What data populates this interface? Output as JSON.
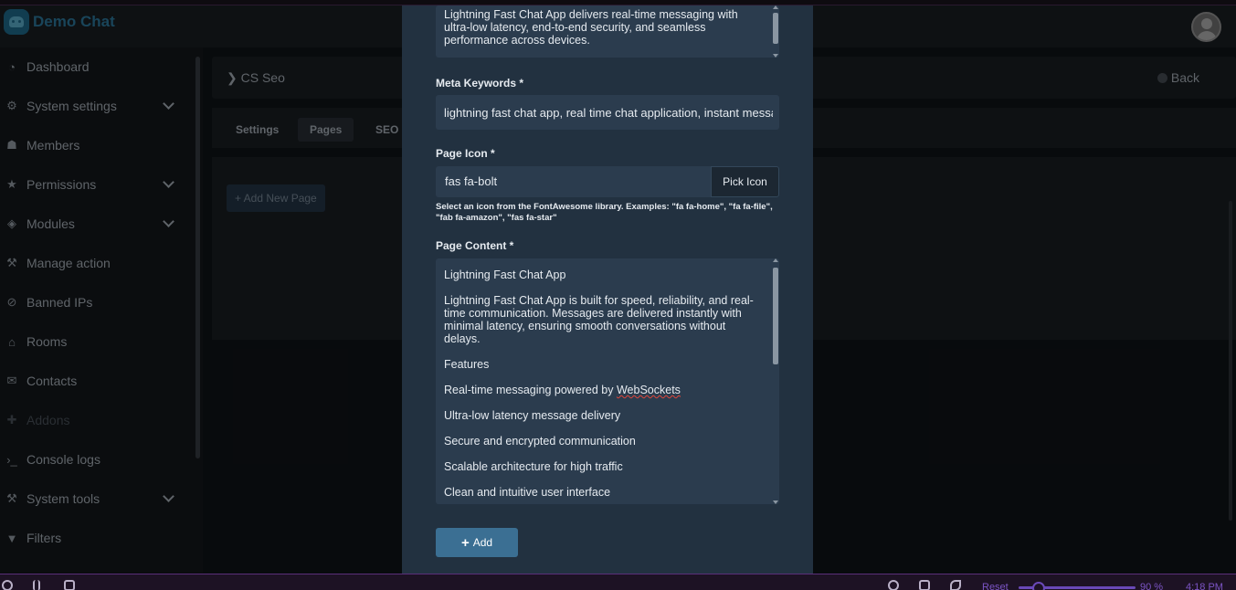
{
  "app": {
    "brand": "Demo Chat"
  },
  "sidebar": {
    "items": [
      {
        "label": "Dashboard",
        "icon": "dashboard-icon",
        "chevron": false
      },
      {
        "label": "System settings",
        "icon": "cogs-icon",
        "chevron": true
      },
      {
        "label": "Members",
        "icon": "users-icon",
        "chevron": false
      },
      {
        "label": "Permissions",
        "icon": "star-icon",
        "chevron": true
      },
      {
        "label": "Modules",
        "icon": "cubes-icon",
        "chevron": true
      },
      {
        "label": "Manage action",
        "icon": "hammer-icon",
        "chevron": false
      },
      {
        "label": "Banned IPs",
        "icon": "ban-icon",
        "chevron": false
      },
      {
        "label": "Rooms",
        "icon": "home-icon",
        "chevron": false
      },
      {
        "label": "Contacts",
        "icon": "envelope-icon",
        "chevron": false
      },
      {
        "label": "Addons",
        "icon": "puzzle-icon",
        "chevron": false
      },
      {
        "label": "Console logs",
        "icon": "terminal-icon",
        "chevron": false
      },
      {
        "label": "System tools",
        "icon": "wrench-icon",
        "chevron": true
      },
      {
        "label": "Filters",
        "icon": "filter-icon",
        "chevron": false
      }
    ]
  },
  "main": {
    "breadcrumb": "CS Seo",
    "back_label": "Back",
    "tabs": [
      {
        "label": "Settings"
      },
      {
        "label": "Pages"
      },
      {
        "label": "SEO C"
      }
    ],
    "add_new_page": "+ Add New Page"
  },
  "modal": {
    "description_text": "Lightning Fast Chat App delivers real-time messaging with ultra-low latency, end-to-end security, and seamless performance across devices.",
    "meta_keywords_label": "Meta Keywords *",
    "meta_keywords_value": "lightning fast chat app, real time chat application, instant messaging",
    "page_icon_label": "Page Icon *",
    "page_icon_value": "fas fa-bolt",
    "pick_icon_label": "Pick Icon",
    "page_icon_help": "Select an icon from the FontAwesome library. Examples: \"fa fa-home\", \"fa fa-file\", \"fab fa-amazon\", \"fas fa-star\"",
    "page_content_label": "Page Content *",
    "page_content": {
      "p1": "Lightning Fast Chat App",
      "p2": "Lightning Fast Chat App is built for speed, reliability, and real-time communication. Messages are delivered instantly with minimal latency, ensuring smooth conversations without delays.",
      "p3": "Features",
      "p4_before": "Real-time messaging powered by ",
      "p4_misspelled": "WebSockets",
      "p5": "Ultra-low latency message delivery",
      "p6": "Secure and encrypted communication",
      "p7": "Scalable architecture for high traffic",
      "p8": "Clean and intuitive user interface"
    },
    "add_button_label": "Add"
  },
  "taskbar": {
    "zoom_reset": "Reset",
    "zoom_value": "90 %",
    "clock": "4:18 PM"
  },
  "colors": {
    "modal_bg": "#223140",
    "input_bg": "#2b3c4e",
    "add_button": "#3b6f93",
    "brand": "#2f7fa5"
  }
}
